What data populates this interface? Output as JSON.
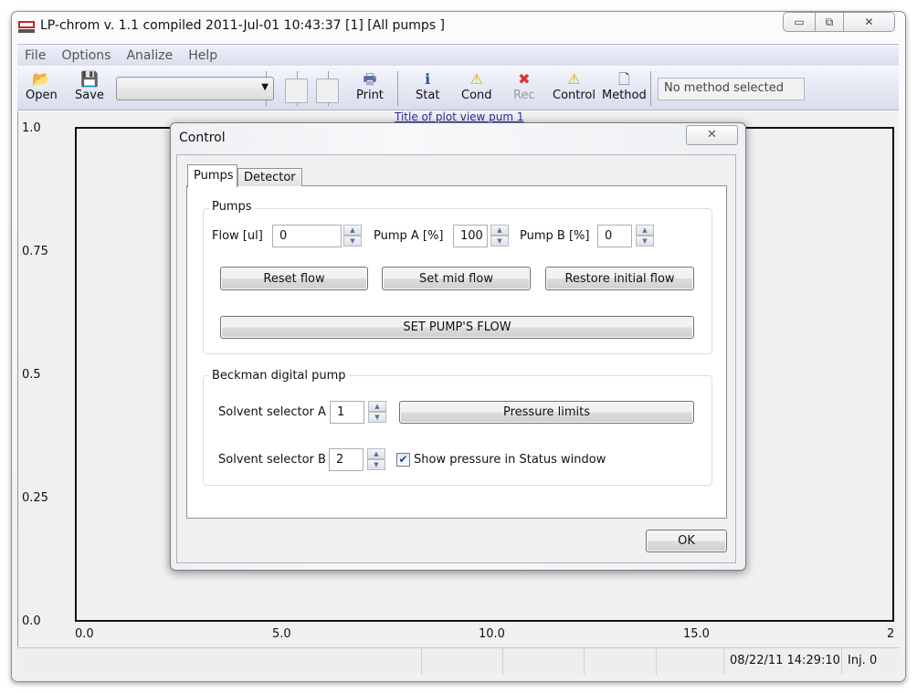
{
  "window": {
    "title": "LP-chrom v. 1.1 compiled 2011-Jul-01 10:43:37 [1] [All pumps ]",
    "minimize": "▭",
    "maximize": "⧉",
    "close": "✕"
  },
  "menu": [
    "File",
    "Options",
    "Analize",
    "Help"
  ],
  "toolbar": {
    "open": {
      "label": "Open",
      "icon": "open-folder-icon"
    },
    "save": {
      "label": "Save",
      "icon": "save-disk-icon"
    },
    "print": {
      "label": "Print",
      "icon": "printer-icon"
    },
    "stat": {
      "label": "Stat",
      "icon": "info-icon"
    },
    "cond": {
      "label": "Cond",
      "icon": "warning-icon"
    },
    "rec": {
      "label": "Rec",
      "icon": "error-icon"
    },
    "control": {
      "label": "Control",
      "icon": "warning-icon"
    },
    "method": {
      "label": "Method",
      "icon": "new-method-icon"
    },
    "method_status": "No method selected"
  },
  "plot": {
    "title": "Title of plot view pum 1"
  },
  "chart_data": {
    "type": "line",
    "title": "Title of plot view pum 1",
    "series": [],
    "ylim": [
      0,
      1.0
    ],
    "yticks": [
      "1.0",
      "0.75",
      "0.5",
      "0.25",
      "0.0"
    ],
    "xticks": [
      "0.0",
      "5.0",
      "10.0",
      "15.0",
      "2"
    ]
  },
  "status": {
    "datetime": "08/22/11 14:29:10",
    "injections": "Inj. 0"
  },
  "dialog": {
    "title": "Control",
    "close": "✕",
    "tabs": [
      "Pumps",
      "Detector"
    ],
    "pumps_group": {
      "title": "Pumps",
      "flow_label": "Flow [ul]",
      "flow": "0",
      "pump_a_label": "Pump A [%]",
      "pump_a": "100",
      "pump_b_label": "Pump B [%]",
      "pump_b": "0",
      "reset": "Reset flow",
      "mid": "Set mid flow",
      "restore": "Restore initial flow",
      "set": "SET PUMP'S FLOW"
    },
    "beckman_group": {
      "title": "Beckman digital pump",
      "sel_a_label": "Solvent selector A",
      "sel_a": "1",
      "sel_b_label": "Solvent selector B",
      "sel_b": "2",
      "pressure": "Pressure limits",
      "show_pressure": "Show pressure in Status window",
      "show_pressure_checked": true
    },
    "ok": "OK"
  }
}
